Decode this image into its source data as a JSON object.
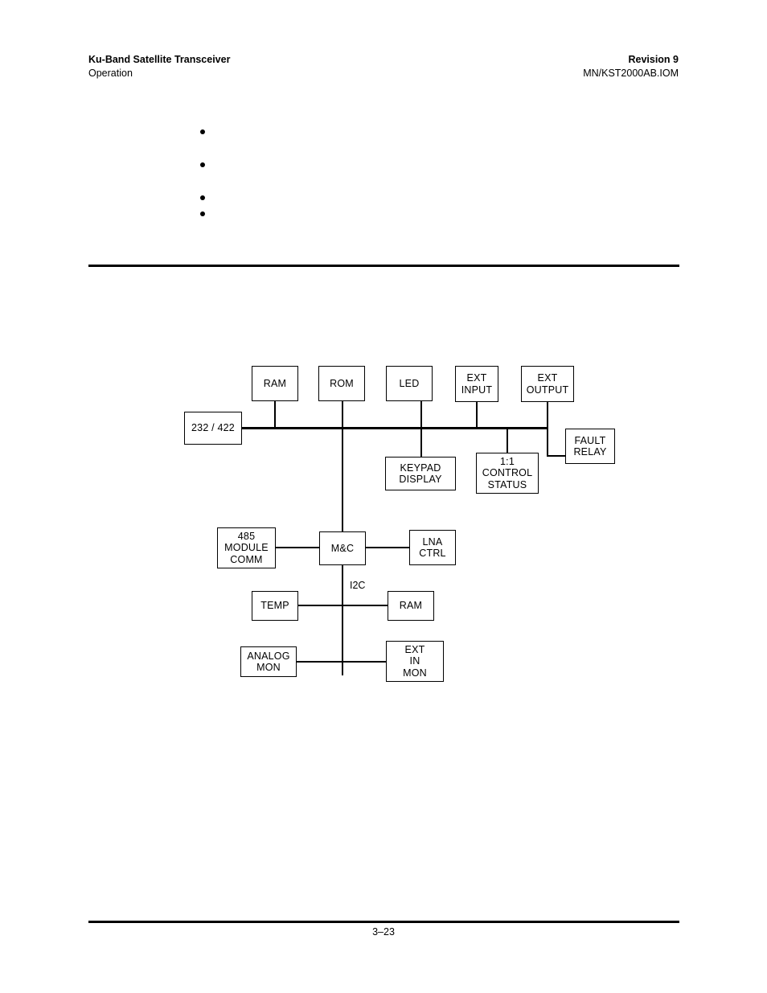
{
  "header": {
    "left_line1": "Ku-Band Satellite Transceiver",
    "left_line2": "Operation",
    "right_line1": "Revision 9",
    "right_line2": "MN/KST2000AB.IOM"
  },
  "bullets": [
    {
      "text": ""
    },
    {
      "text": ""
    },
    {
      "text": ""
    },
    {
      "text": ""
    }
  ],
  "footer": {
    "page_number": "3–23"
  },
  "diagram": {
    "nodes": [
      {
        "id": "ram_top",
        "label": "RAM"
      },
      {
        "id": "rom",
        "label": "ROM"
      },
      {
        "id": "led",
        "label": "LED"
      },
      {
        "id": "ext_input",
        "label": "EXT\nINPUT"
      },
      {
        "id": "ext_output",
        "label": "EXT\nOUTPUT"
      },
      {
        "id": "serial_232_422",
        "label": "232 / 422"
      },
      {
        "id": "fault_relay",
        "label": "FAULT\nRELAY"
      },
      {
        "id": "keypad_display",
        "label": "KEYPAD\nDISPLAY"
      },
      {
        "id": "control_status",
        "label": "1:1\nCONTROL\nSTATUS"
      },
      {
        "id": "module_comm",
        "label": "485\nMODULE\nCOMM"
      },
      {
        "id": "mc",
        "label": "M&C"
      },
      {
        "id": "lna_ctrl",
        "label": "LNA\nCTRL"
      },
      {
        "id": "temp",
        "label": "TEMP"
      },
      {
        "id": "ram_bottom",
        "label": "RAM"
      },
      {
        "id": "analog_mon",
        "label": "ANALOG\nMON"
      },
      {
        "id": "ext_in_mon",
        "label": "EXT\nIN\nMON"
      }
    ],
    "edge_labels": [
      {
        "id": "i2c",
        "label": "I2C"
      }
    ]
  },
  "colors": {
    "ink": "#000000",
    "paper": "#ffffff"
  }
}
